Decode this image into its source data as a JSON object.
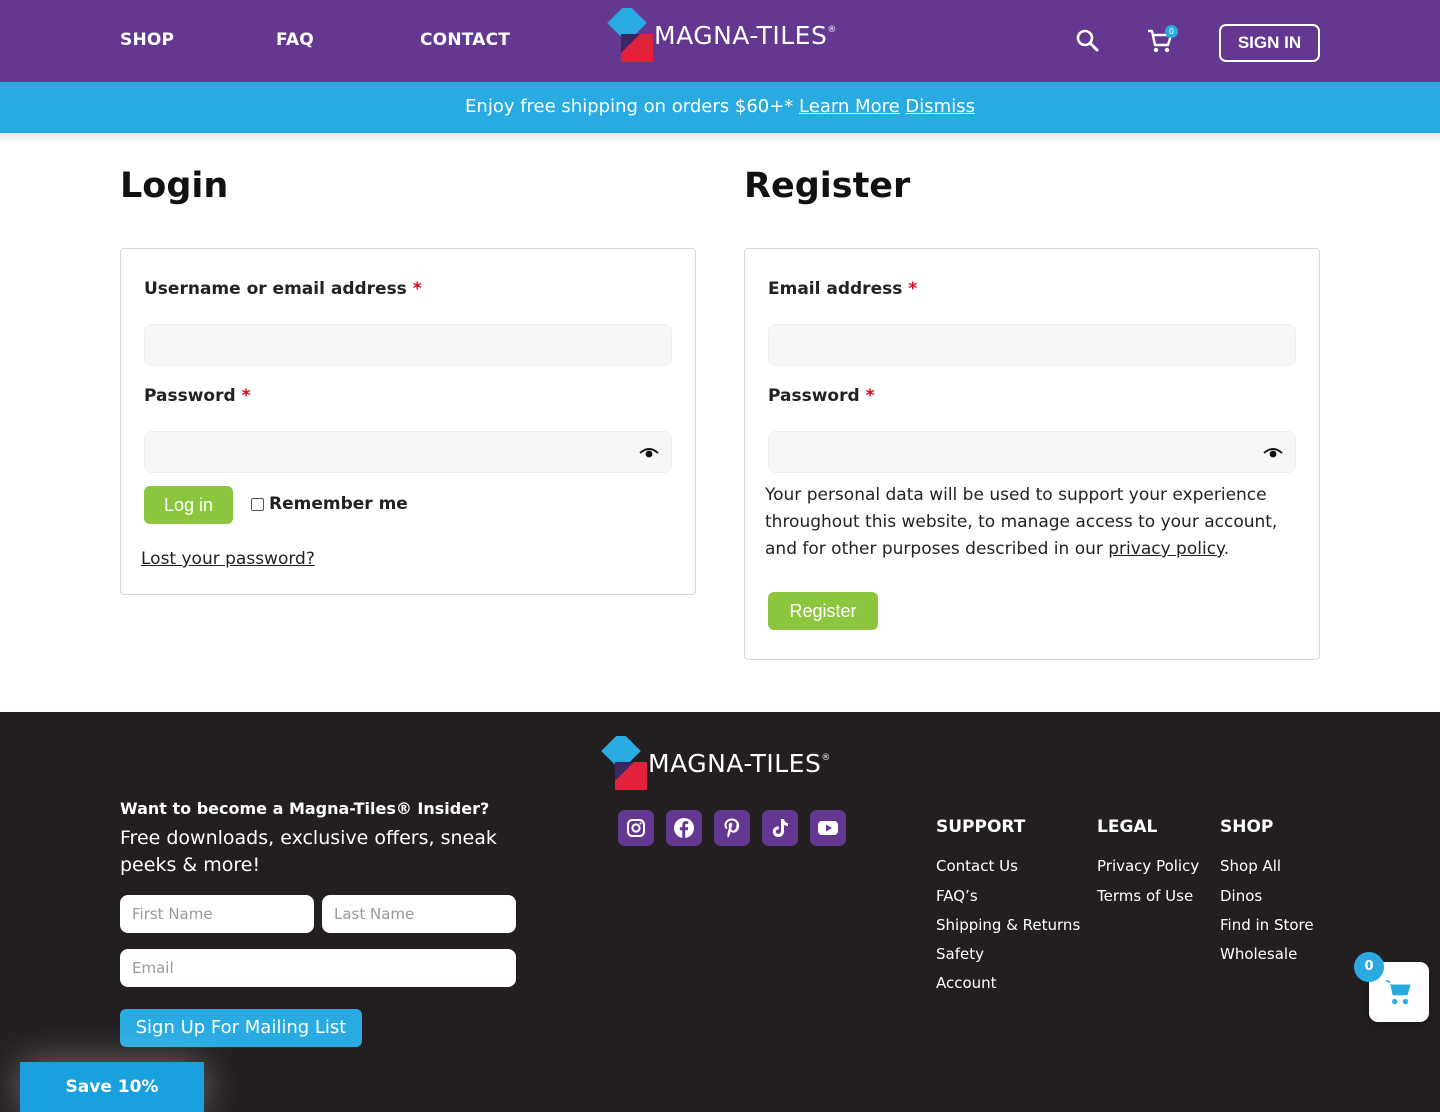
{
  "header": {
    "nav": [
      "SHOP",
      "FAQ",
      "CONTACT"
    ],
    "logo_text": "MAGNA-TILES",
    "logo_reg": "®",
    "cart_count": "0",
    "signin_label": "SIGN IN"
  },
  "banner": {
    "text": "Enjoy free shipping on orders $60+* ",
    "learn_more": "Learn More",
    "dismiss": "Dismiss"
  },
  "login": {
    "title": "Login",
    "username_label": "Username or email address",
    "password_label": "Password",
    "required_mark": "*",
    "login_button": "Log in",
    "remember_label": "Remember me",
    "lost_password": "Lost your password?"
  },
  "register": {
    "title": "Register",
    "email_label": "Email address",
    "password_label": "Password",
    "required_mark": "*",
    "privacy_text": "Your personal data will be used to support your experience throughout this website, to manage access to your account, and for other purposes described in our ",
    "privacy_link": "privacy policy",
    "privacy_end": ".",
    "register_button": "Register"
  },
  "footer": {
    "logo_text": "MAGNA-TILES",
    "logo_reg": "®",
    "insider_title": "Want to become a Magna-Tiles® Insider?",
    "insider_sub": "Free downloads, exclusive offers, sneak peeks & more!",
    "first_name_placeholder": "First Name",
    "last_name_placeholder": "Last Name",
    "email_placeholder": "Email",
    "signup_button": "Sign Up For Mailing List",
    "social": [
      "instagram-icon",
      "facebook-icon",
      "pinterest-icon",
      "tiktok-icon",
      "youtube-icon"
    ],
    "columns": {
      "support": {
        "title": "SUPPORT",
        "links": [
          "Contact Us",
          "FAQ’s",
          "Shipping & Returns",
          "Safety",
          "Account"
        ]
      },
      "legal": {
        "title": "LEGAL",
        "links": [
          "Privacy Policy",
          "Terms of Use"
        ]
      },
      "shop": {
        "title": "SHOP",
        "links": [
          "Shop All",
          "Dinos",
          "Find in Store",
          "Wholesale"
        ]
      }
    },
    "save_label": "Save 10%",
    "float_cart_count": "0"
  },
  "colors": {
    "brand_purple": "#643891",
    "banner_blue": "#29abe2",
    "button_green": "#8cc63f",
    "footer_bg": "#231f20",
    "required_red": "#e2001a"
  }
}
